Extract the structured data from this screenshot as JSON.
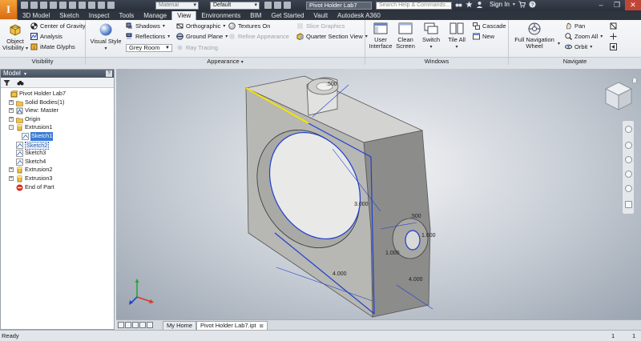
{
  "qat": {
    "material_placeholder": "Material",
    "appearance_value": "Default",
    "window_title": "Pivot Holder Lab7",
    "search_placeholder": "Search Help & Commands...",
    "sign_in": "Sign In"
  },
  "tabs": [
    "3D Model",
    "Sketch",
    "Inspect",
    "Tools",
    "Manage",
    "View",
    "Environments",
    "BIM",
    "Get Started",
    "Vault",
    "Autodesk A360"
  ],
  "active_tab": "View",
  "ribbon": {
    "visibility": {
      "object_visibility": "Object Visibility",
      "center_of_gravity": "Center of Gravity",
      "analysis": "Analysis",
      "imate_glyphs": "iMate Glyphs",
      "label": "Visibility"
    },
    "appearance": {
      "visual_style": "Visual Style",
      "shadows": "Shadows",
      "reflections": "Reflections",
      "orthographic": "Orthographic",
      "ground_plane": "Ground Plane",
      "textures_on": "Textures On",
      "refine_appearance": "Refine Appearance",
      "ray_tracing": "Ray Tracing",
      "lighting_style": "Grey Room",
      "label": "Appearance"
    },
    "slice": {
      "slice_graphics": "Slice Graphics",
      "quarter_section_view": "Quarter Section View"
    },
    "windows": {
      "user_interface": "User Interface",
      "clean_screen": "Clean Screen",
      "switch": "Switch",
      "tile_all": "Tile All",
      "cascade": "Cascade",
      "new": "New",
      "label": "Windows"
    },
    "navigate": {
      "full_navigation_wheel": "Full Navigation Wheel",
      "pan": "Pan",
      "zoom_all": "Zoom All",
      "orbit": "Orbit",
      "label": "Navigate"
    }
  },
  "browser": {
    "title": "Model",
    "tree": [
      {
        "label": "Pivot Holder Lab7",
        "indent": 0,
        "expander": "",
        "icon": "part-icon",
        "style": ""
      },
      {
        "label": "Solid Bodies(1)",
        "indent": 1,
        "expander": "+",
        "icon": "folder-icon",
        "style": ""
      },
      {
        "label": "View: Master",
        "indent": 1,
        "expander": "+",
        "icon": "view-icon",
        "style": ""
      },
      {
        "label": "Origin",
        "indent": 1,
        "expander": "+",
        "icon": "folder-icon",
        "style": ""
      },
      {
        "label": "Extrusion1",
        "indent": 1,
        "expander": "-",
        "icon": "extrusion-icon",
        "style": ""
      },
      {
        "label": "Sketch1",
        "indent": 2,
        "expander": "",
        "icon": "sketch-icon",
        "style": "hl"
      },
      {
        "label": "Sketch2",
        "indent": 1,
        "expander": "",
        "icon": "sketch-icon",
        "style": "hl2"
      },
      {
        "label": "Sketch3",
        "indent": 1,
        "expander": "",
        "icon": "sketch-icon",
        "style": ""
      },
      {
        "label": "Sketch4",
        "indent": 1,
        "expander": "",
        "icon": "sketch-icon",
        "style": ""
      },
      {
        "label": "Extrusion2",
        "indent": 1,
        "expander": "+",
        "icon": "extrusion-icon",
        "style": ""
      },
      {
        "label": "Extrusion3",
        "indent": 1,
        "expander": "+",
        "icon": "extrusion-icon",
        "style": ""
      },
      {
        "label": "End of Part",
        "indent": 1,
        "expander": "",
        "icon": "end-of-part-icon",
        "style": ""
      }
    ]
  },
  "viewport": {
    "dimensions": {
      "d1": ".500",
      "d2": "3.000",
      "d3": ".500",
      "d4": "1.000",
      "d5": "4.000",
      "d6": "1.000",
      "d7": "4.000"
    }
  },
  "doc_tabs": {
    "home": "My Home",
    "document": "Pivot Holder Lab7.ipt"
  },
  "status": {
    "text": "Ready",
    "num1": "1",
    "num2": "1"
  },
  "colors": {
    "app_button": "#e8821f",
    "edge_highlight": "#f2e400",
    "sketch_blue": "#1f3fd0",
    "selection_blue": "#3a7bd5"
  }
}
